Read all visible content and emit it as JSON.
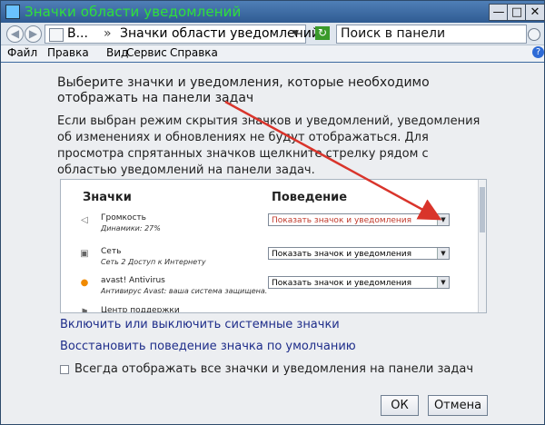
{
  "window": {
    "title": "Значки области уведомлений",
    "buttons": {
      "minimize": "—",
      "maximize": "□",
      "close": "✕"
    }
  },
  "toolbar": {
    "back_glyph": "◀",
    "forward_glyph": "▶",
    "address_parts": [
      "В...",
      "»",
      "Значки области уведомлений"
    ],
    "address_dropdown": "▼",
    "refresh_glyph": "↻",
    "search_placeholder": "Поиск в панели управления"
  },
  "menu": [
    "Файл",
    "Правка",
    "Вид",
    "Сервис",
    "Справка"
  ],
  "content": {
    "heading": "Выберите значки и уведомления, которые необходимо отображать на панели задач",
    "description": "Если выбран режим скрытия значков и уведомлений, уведомления об изменениях и обновлениях не будут отображаться. Для просмотра спрятанных значков щелкните стрелку рядом с областью уведомлений на панели задач.",
    "table": {
      "columns": [
        "Значки",
        "Поведение"
      ],
      "rows": [
        {
          "name": "Громкость",
          "subtitle": "Динамики: 27%",
          "behavior": "Показать значок и уведомления",
          "highlight": true,
          "icon": "speaker-icon"
        },
        {
          "name": "Сеть",
          "subtitle": "Сеть  2 Доступ к Интернету",
          "behavior": "Показать значок и уведомления",
          "highlight": false,
          "icon": "network-icon"
        },
        {
          "name": "avast! Antivirus",
          "subtitle": "Антивирус Avast: ваша система защищена.",
          "behavior": "Показать значок и уведомления",
          "highlight": false,
          "icon": "avast-icon"
        },
        {
          "name": "Центр поддержки",
          "subtitle": "",
          "behavior": "",
          "highlight": false,
          "icon": "flag-icon"
        }
      ]
    },
    "links": {
      "system_icons": "Включить или выключить системные значки",
      "restore_default": "Восстановить поведение значка по умолчанию"
    },
    "checkbox_label": "Всегда отображать все значки и уведомления на панели задач",
    "checkbox_checked": false
  },
  "footer": {
    "ok": "ОК",
    "cancel": "Отмена"
  },
  "colors": {
    "title_text": "#2ee03a",
    "link": "#1e2d8a",
    "highlight_text": "#c0392b",
    "annotation_arrow": "#d9342b"
  }
}
